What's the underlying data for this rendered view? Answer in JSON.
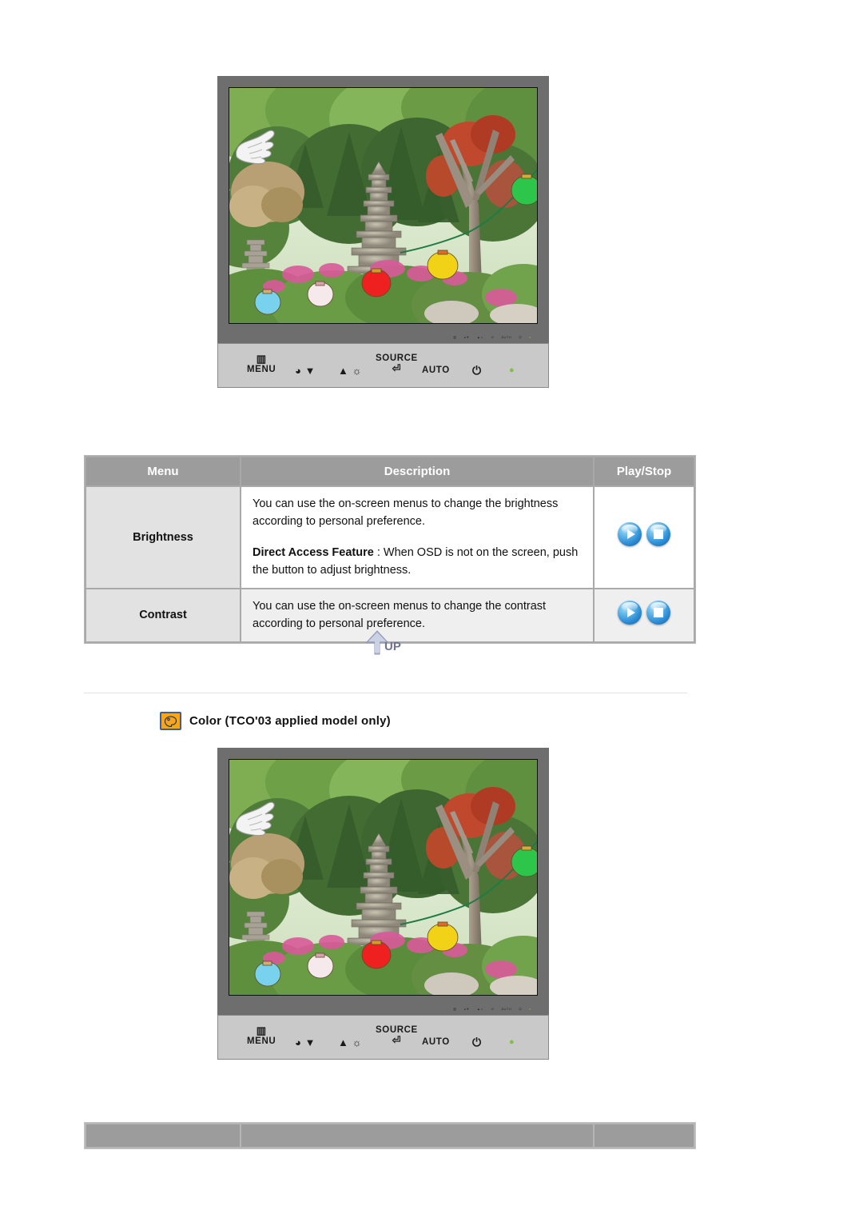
{
  "page": {
    "background": "#ffffff"
  },
  "monitor_top": {
    "name": "monitor-illustration-brightness",
    "screen_image": {
      "description": "Korean garden photograph with stone pagoda, green trees, azalea flowers and colored paper lanterns",
      "lanterns": [
        "green",
        "yellow",
        "red",
        "white-pink",
        "light-blue"
      ]
    },
    "osd_mini_labels": [
      "MENU",
      "▼",
      "▲",
      "SOURCE",
      "AUTO",
      "⏻"
    ],
    "control_panel": {
      "buttons": [
        {
          "glyph": "☰",
          "label": "MENU",
          "name": "menu-button"
        },
        {
          "glyph": "◕▼",
          "label": "",
          "name": "down-button"
        },
        {
          "glyph": "▲ ☀",
          "label": "",
          "name": "up-brightness-button"
        },
        {
          "glyph": "↵",
          "label": "SOURCE",
          "name": "source-enter-button"
        },
        {
          "glyph": "",
          "label": "AUTO",
          "name": "auto-button"
        },
        {
          "glyph": "⏻",
          "label": "",
          "name": "power-button"
        },
        {
          "glyph": "●",
          "label": "",
          "name": "power-led-indicator"
        }
      ],
      "led_color": "#7fc241"
    },
    "hand_cursor": "pointing-hand"
  },
  "table": {
    "headers": [
      "Menu",
      "Description",
      "Play/Stop"
    ],
    "rows": [
      {
        "menu": "Brightness",
        "description_paragraphs": [
          {
            "bold_lead": "",
            "text": "You can use the on-screen menus to change the brightness according to personal preference."
          },
          {
            "bold_lead": "Direct Access Feature",
            "text": " : When OSD is not on the screen, push the button to adjust brightness."
          }
        ],
        "play_stop": [
          "play",
          "stop"
        ]
      },
      {
        "menu": "Contrast",
        "description_paragraphs": [
          {
            "bold_lead": "",
            "text": "You can use the on-screen menus to change the contrast according to personal preference."
          }
        ],
        "play_stop": [
          "play",
          "stop"
        ]
      }
    ]
  },
  "up_button": {
    "label": "UP",
    "name": "up-scroll-button"
  },
  "section": {
    "icon_name": "color-palette-icon",
    "title": "Color (TCO'03 applied model only)"
  },
  "monitor_bottom": {
    "name": "monitor-illustration-color",
    "screen_image": {
      "description": "Korean garden photograph with stone pagoda, green trees, azalea flowers and colored paper lanterns",
      "lanterns": [
        "green",
        "yellow",
        "red",
        "white-pink",
        "light-blue"
      ]
    },
    "osd_mini_labels": [
      "MENU",
      "▼",
      "▲",
      "SOURCE",
      "AUTO",
      "⏻"
    ],
    "control_panel": {
      "buttons": [
        {
          "glyph": "☰",
          "label": "MENU",
          "name": "menu-button"
        },
        {
          "glyph": "◕▼",
          "label": "",
          "name": "down-button"
        },
        {
          "glyph": "▲ ☀",
          "label": "",
          "name": "up-brightness-button"
        },
        {
          "glyph": "↵",
          "label": "SOURCE",
          "name": "source-enter-button"
        },
        {
          "glyph": "",
          "label": "AUTO",
          "name": "auto-button"
        },
        {
          "glyph": "⏻",
          "label": "",
          "name": "power-button"
        },
        {
          "glyph": "●",
          "label": "",
          "name": "power-led-indicator"
        }
      ],
      "led_color": "#7fc241"
    },
    "hand_cursor": "pointing-hand"
  },
  "bottom_table": {
    "columns": 3,
    "cells": [
      "",
      "",
      ""
    ]
  },
  "colors": {
    "bezel": "#6e6e6e",
    "panel": "#c9c9c9",
    "table_header": "#9c9c9c",
    "table_menu_cell": "#e2e2e2",
    "accent_icon": "#f5a718",
    "icon_border": "#3a5bb0",
    "button_blue": "#2f8fd6"
  }
}
